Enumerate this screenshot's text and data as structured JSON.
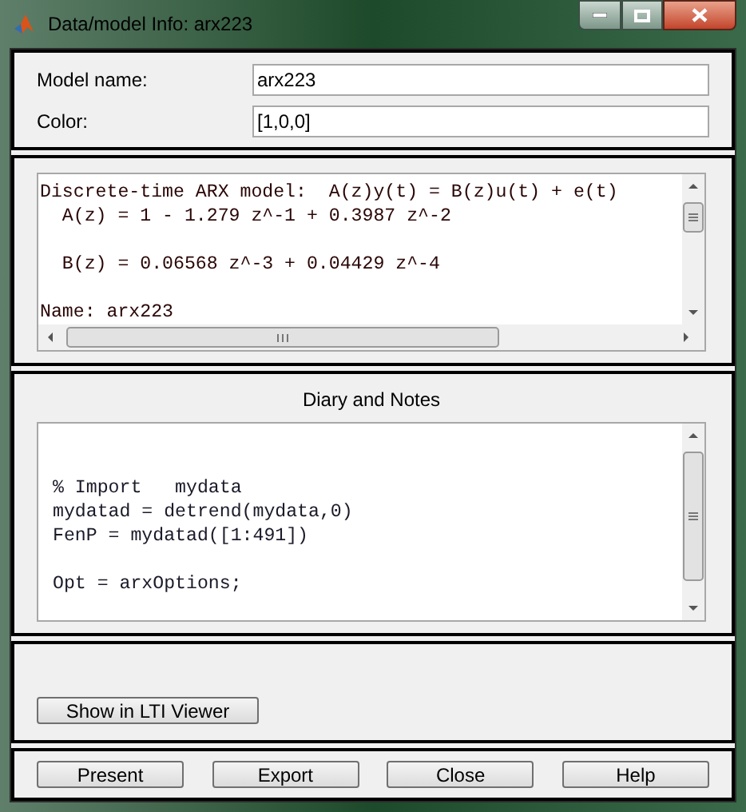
{
  "window": {
    "title": "Data/model Info: arx223"
  },
  "fields": [
    {
      "label": "Model name:",
      "value": "arx223"
    },
    {
      "label": "Color:",
      "value": "[1,0,0]"
    }
  ],
  "model_text": {
    "blocks": [
      [
        "Discrete-time ARX model:  A(z)y(t) = B(z)u(t) + e(t)",
        "  A(z) = 1 - 1.279 z^-1 + 0.3987 z^-2"
      ],
      [
        "  B(z) = 0.06568 z^-3 + 0.04429 z^-4"
      ],
      [
        "Name: arx223"
      ]
    ]
  },
  "notes": {
    "title": "Diary and Notes",
    "blocks": [
      [
        "% Import   mydata",
        "mydatad = detrend(mydata,0)",
        "FenP = mydatad([1:491])"
      ],
      [
        "Opt = arxOptions;"
      ]
    ]
  },
  "show_button": "Show in LTI Viewer",
  "buttons": [
    "Present",
    "Export",
    "Close",
    "Help"
  ]
}
